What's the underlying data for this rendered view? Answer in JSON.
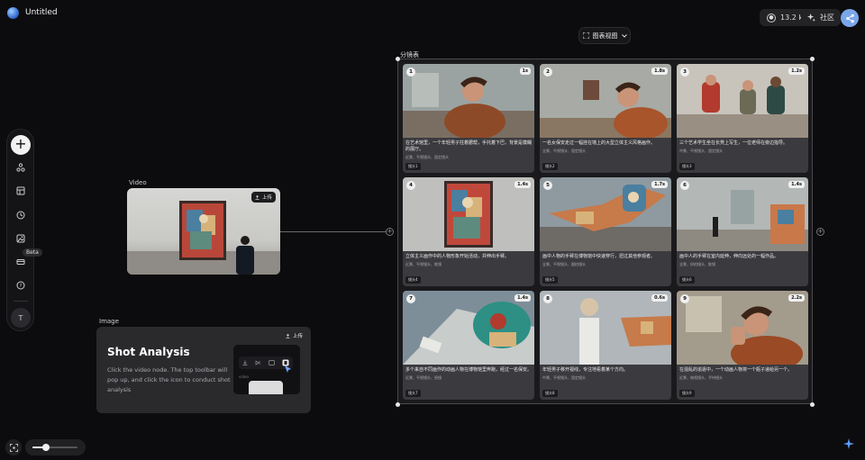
{
  "header": {
    "title": "Untitled",
    "credits": "13.2 k",
    "community_label": "社区"
  },
  "view_toggle": {
    "label": "图表视图"
  },
  "sidebar": {
    "beta_label": "Beta",
    "avatar_initial": "T"
  },
  "video_node": {
    "label": "Video",
    "upload_label": "上传"
  },
  "image_node": {
    "label": "Image",
    "upload_label": "上传",
    "title": "Shot Analysis",
    "text": "Click the video node. The top toolbar will pop up, and click the icon to conduct shot analysis",
    "preview_caption": "video"
  },
  "storyboard": {
    "label": "分镜表",
    "shots": [
      {
        "num": "1",
        "duration": "1s",
        "description": "在艺术馆里，一个年轻男子拄着腮帮，手托着下巴，背景是模糊的展厅。",
        "meta": "近景、平视镜头、固定镜头",
        "tag": "镜头1"
      },
      {
        "num": "2",
        "duration": "1.8s",
        "description": "一名女保安走过一幅挂在墙上的大型立体主义风格画作。",
        "meta": "全景、平视镜头、固定镜头",
        "tag": "镜头2"
      },
      {
        "num": "3",
        "duration": "1.2s",
        "description": "三个艺术学生坐在长凳上写生，一位老师在旁边指导。",
        "meta": "中景、平视镜头、固定镜头",
        "tag": "镜头3"
      },
      {
        "num": "4",
        "duration": "1.4s",
        "description": "立体主义画作中的人物形象开始活动，并伸出手臂。",
        "meta": "近景、平视镜头、推镜",
        "tag": "镜头4"
      },
      {
        "num": "5",
        "duration": "1.7s",
        "description": "画中人物的手臂在博物馆中快速穿行，扭过其他参观者。",
        "meta": "全景、平视镜头、跟拍镜头",
        "tag": "镜头5"
      },
      {
        "num": "6",
        "duration": "1.4s",
        "description": "画中人的手臂在室内延伸，伸向远处的一幅作品。",
        "meta": "全景、仰拍镜头、推镜",
        "tag": "镜头6"
      },
      {
        "num": "7",
        "duration": "1.4s",
        "description": "多个来自不同画作的动画人物在博物馆里奔跑，经过一名保安。",
        "meta": "近景、平视镜头、摇镜",
        "tag": "镜头7"
      },
      {
        "num": "8",
        "duration": "0.6s",
        "description": "年轻男子移开视线，专注地看着某个方向。",
        "meta": "中景、平视镜头、固定镜头",
        "tag": "镜头8"
      },
      {
        "num": "9",
        "duration": "2.2s",
        "description": "在混乱的追逐中，一个动画人物将一个瓶子递给另一个。",
        "meta": "近景、俯视镜头、手持镜头",
        "tag": "镜头9"
      }
    ]
  },
  "zoom": {
    "level": 0.3
  },
  "colors": {
    "accent": "#7aa7ea",
    "background": "#0c0c0e",
    "panel": "#2a2a2d"
  }
}
